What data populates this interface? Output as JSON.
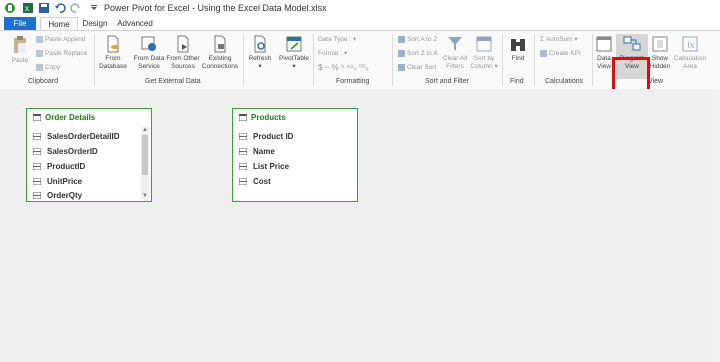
{
  "window": {
    "title": "Power Pivot for Excel - Using the Excel Data Model.xlsx"
  },
  "tabs": [
    "File",
    "Home",
    "Design",
    "Advanced"
  ],
  "ribbon": {
    "clipboard": {
      "paste": "Paste",
      "paste_append": "Paste Append",
      "paste_replace": "Paste Replace",
      "copy": "Copy",
      "label": "Clipboard"
    },
    "external": {
      "from_database": [
        "From",
        "Database"
      ],
      "from_data_service": [
        "From Data",
        "Service"
      ],
      "from_other": [
        "From Other",
        "Sources"
      ],
      "existing": [
        "Existing",
        "Connections"
      ],
      "label": "Get External Data"
    },
    "refresh": "Refresh",
    "pivottable": "PivotTable",
    "formatting": {
      "data_type": "Data Type :",
      "format": "Format :",
      "symbols": "$ ~ % ⁹ ⁴⁸₀ ⁰⁰₀",
      "label": "Formatting"
    },
    "sort_filter": {
      "sort_az": "Sort A to Z",
      "sort_za": "Sort Z to A",
      "clear_sort": "Clear Sort",
      "clear_all": [
        "Clear All",
        "Filters"
      ],
      "sort_by": [
        "Sort by",
        "Column"
      ],
      "label": "Sort and Filter"
    },
    "find": {
      "btn": "Find",
      "label": "Find"
    },
    "calculations": {
      "autosum": "AutoSum",
      "kpi": "Create KPI",
      "label": "Calculations"
    },
    "view": {
      "data_view": [
        "Data",
        "View"
      ],
      "diagram_view": [
        "Diagram",
        "View"
      ],
      "show_hidden": [
        "Show",
        "Hidden"
      ],
      "calc_area": [
        "Calculation",
        "Area"
      ],
      "label": "View"
    }
  },
  "tables": [
    {
      "name": "Order Details",
      "fields": [
        "SalesOrderDetailID",
        "SalesOrderID",
        "ProductID",
        "UnitPrice",
        "OrderQty"
      ]
    },
    {
      "name": "Products",
      "fields": [
        "Product ID",
        "Name",
        "List Price",
        "Cost"
      ]
    }
  ],
  "colors": {
    "accent": "#1e6fd0",
    "table_border": "#3aa13a",
    "table_title": "#1f7a1f",
    "highlight": "#e30b0b"
  }
}
